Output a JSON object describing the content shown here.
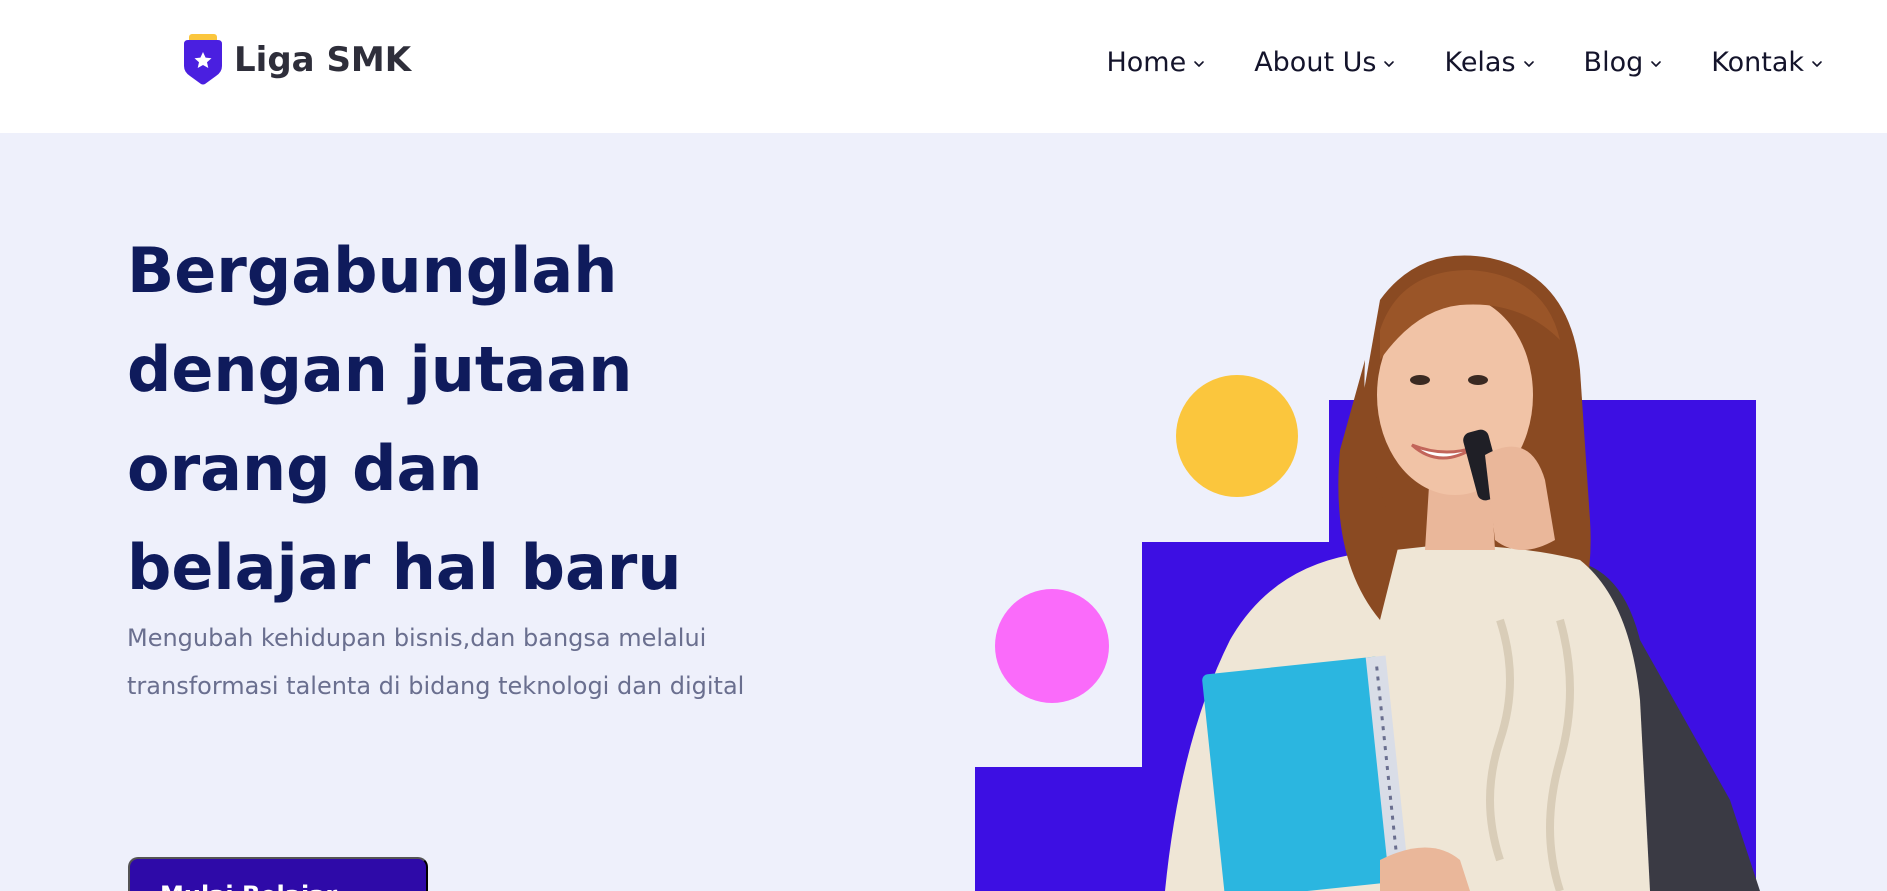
{
  "brand": {
    "name": "Liga SMK",
    "logo_icon": "shield-star-icon",
    "logo_color": "#4a1fe0"
  },
  "nav": {
    "items": [
      {
        "label": "Home",
        "icon": "chevron-down-icon"
      },
      {
        "label": "About Us",
        "icon": "chevron-down-icon"
      },
      {
        "label": "Kelas",
        "icon": "chevron-down-icon"
      },
      {
        "label": "Blog",
        "icon": "chevron-down-icon"
      },
      {
        "label": "Kontak",
        "icon": "chevron-down-icon"
      }
    ]
  },
  "hero": {
    "title_lines": [
      "Bergabunglah",
      "dengan jutaan",
      "orang dan",
      "belajar hal baru"
    ],
    "subtitle_lines": [
      "Mengubah kehidupan bisnis,dan bangsa melalui",
      "transformasi talenta di bidang teknologi dan digital"
    ],
    "cta_label": "Mulai Belajar"
  },
  "colors": {
    "accent": "#3d0fe3",
    "title": "#0f1b5c",
    "yellow_circle": "#fbc63d",
    "pink_circle": "#fa6bfa",
    "background": "#eef0fb"
  }
}
